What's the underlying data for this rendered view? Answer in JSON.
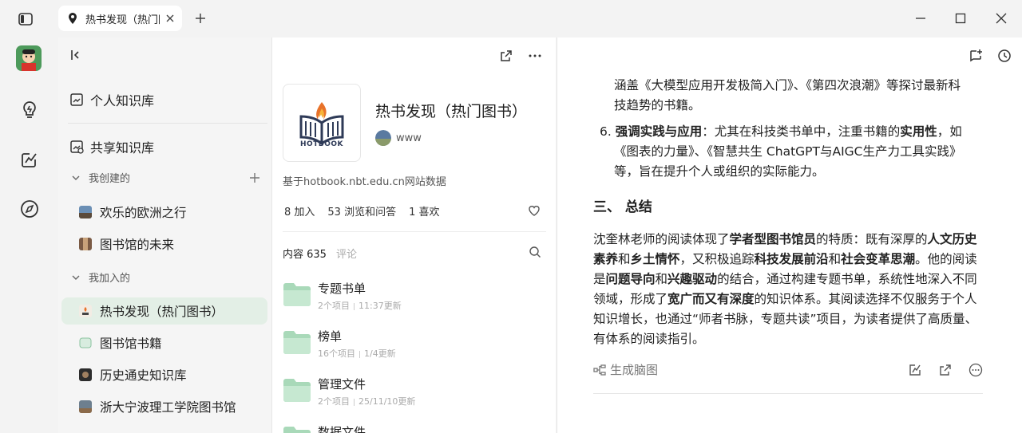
{
  "tab": {
    "title": "热书发现（热门图书）"
  },
  "sidebar": {
    "personal": "个人知识库",
    "shared": "共享知识库",
    "created_group": "我创建的",
    "created_items": [
      "欢乐的欧洲之行",
      "图书馆的未来"
    ],
    "joined_group": "我加入的",
    "joined_items": [
      "热书发现（热门图书）",
      "图书馆书籍",
      "历史通史知识库",
      "浙大宁波理工学院图书馆"
    ]
  },
  "middle": {
    "cover_label": "HOTBOOK",
    "title": "热书发现（热门图书）",
    "owner": "www",
    "description": "基于hotbook.nbt.edu.cn网站数据",
    "stats": [
      "8 加入",
      "53 浏览和问答",
      "1 喜欢"
    ],
    "tab_content": "内容 635",
    "tab_comments": "评论",
    "folders": [
      {
        "name": "专题书单",
        "count": "2个项目",
        "updated": "11:37更新"
      },
      {
        "name": "榜单",
        "count": "16个项目",
        "updated": "1/4更新"
      },
      {
        "name": "管理文件",
        "count": "2个项目",
        "updated": "25/11/10更新"
      },
      {
        "name": "数据文件",
        "count": "",
        "updated": ""
      }
    ]
  },
  "right": {
    "p1_line1": "涵盖《大模型应用开发极简入门》、《第四次浪潮》等探讨最新科",
    "p1_line2": "技趋势的书籍。",
    "item6_num": "6.",
    "item6_bold": "强调实践与应用",
    "item6_a": "：尤其在科技类书单中，注重书籍的",
    "item6_bold2": "实用性",
    "item6_b": "，如",
    "item6_line2": "《图表的力量》、《智慧共生 ChatGPT与AIGC生产力工具实践》",
    "item6_line3": "等，旨在提升个人或组织的实际能力。",
    "heading": "三、 总结",
    "s_a": "沈奎林老师的阅读体现了",
    "s_b": "学者型图书馆员",
    "s_c": "的特质：既有深厚的",
    "s_d": "人文历史",
    "s_e": "素养",
    "s_f": "和",
    "s_g": "乡土情怀",
    "s_h": "，又积极追踪",
    "s_i": "科技发展前沿",
    "s_j": "和",
    "s_k": "社会变革思潮",
    "s_l": "。他的阅读",
    "s_m": "是",
    "s_n": "问题导向",
    "s_o": "和",
    "s_p": "兴趣驱动",
    "s_q": "的结合，通过构建专题书单，系统性地深入不同",
    "s_r": "领域，形成了",
    "s_s": "宽广而又有深度",
    "s_t": "的知识体系。其阅读选择不仅服务于个人",
    "s_u": "知识增长，也通过“师者书脉，专题共读”项目，为读者提供了高质量、",
    "s_v": "有体系的阅读指引。",
    "gen_map": "生成脑图"
  },
  "colors": {
    "accent": "#3a9a5a",
    "active_bg": "#e3efe6",
    "folder": "#a9d9b9"
  }
}
